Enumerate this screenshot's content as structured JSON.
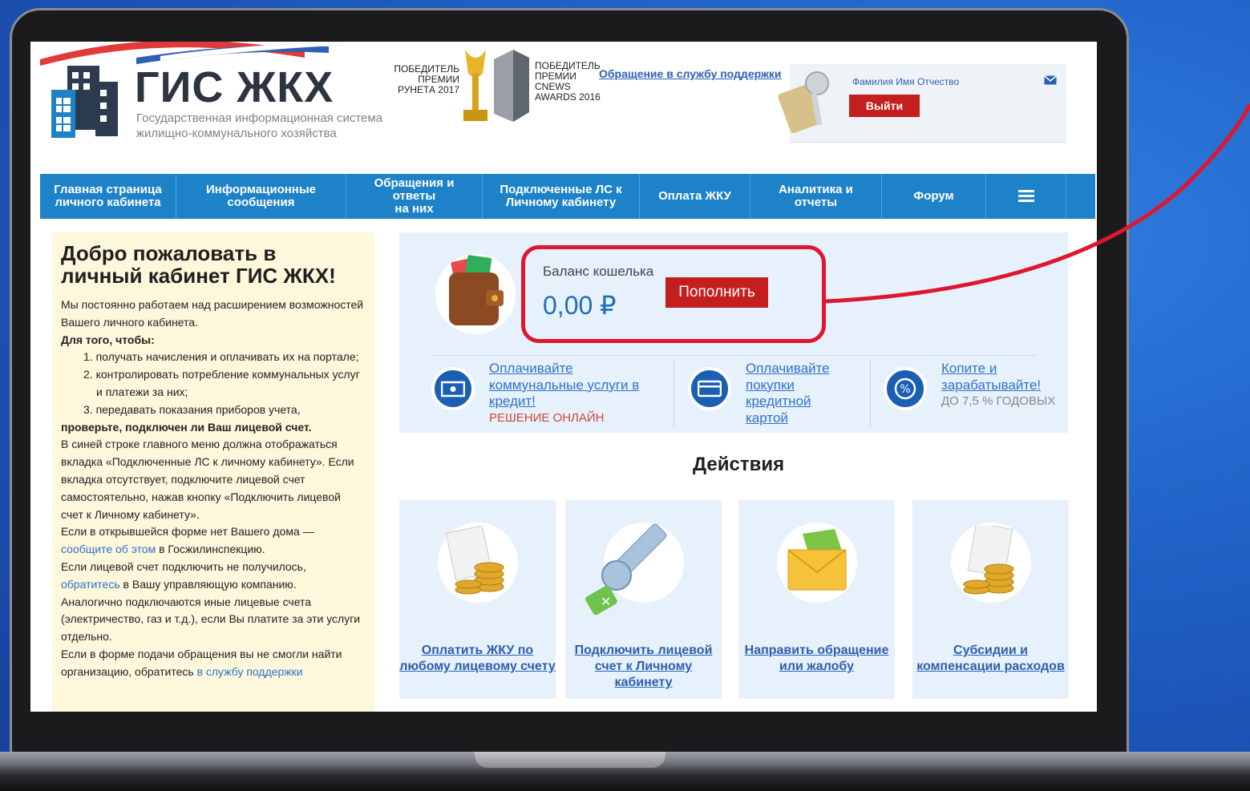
{
  "header": {
    "logo_title": "ГИС ЖКХ",
    "logo_sub_line1": "Государственная информационная система",
    "logo_sub_line2": "жилищно-коммунального хозяйства",
    "award1_line1": "ПОБЕДИТЕЛЬ",
    "award1_line2": "ПРЕМИИ",
    "award1_line3": "РУНЕТА 2017",
    "award2_line1": "ПОБЕДИТЕЛЬ",
    "award2_line2": "ПРЕМИИ",
    "award2_line3": "CNEWS",
    "award2_line4": "AWARDS 2016",
    "support_link": "Обращение в службу поддержки",
    "user_name": "Фамилия Имя Отчество",
    "logout": "Выйти"
  },
  "nav": {
    "items": [
      {
        "l1": "Главная страница",
        "l2": "личного кабинета"
      },
      {
        "l1": "Информационные",
        "l2": "сообщения"
      },
      {
        "l1": "Обращения и ответы",
        "l2": "на них"
      },
      {
        "l1": "Подключенные ЛС к",
        "l2": "Личному кабинету"
      },
      {
        "l1": "Оплата ЖКУ",
        "l2": ""
      },
      {
        "l1": "Аналитика и отчеты",
        "l2": ""
      },
      {
        "l1": "Форум",
        "l2": ""
      }
    ],
    "menu_icon": "hamburger-icon"
  },
  "left": {
    "title": "Добро пожаловать в личный кабинет ГИС ЖКХ!",
    "p1": "Мы постоянно работаем над расширением возможностей Вашего личного кабинета.",
    "p2": "Для того, чтобы:",
    "li1": "1. получать начисления и оплачивать их на портале;",
    "li2": "2. контролировать потребление коммунальных услуг и платежи за них;",
    "li3": "3. передавать показания приборов учета,",
    "p3": "проверьте, подключен ли Ваш лицевой счет.",
    "p4": "В синей строке главного меню должна отображаться вкладка «Подключенные ЛС к личному кабинету». Если вкладка отсутствует, подключите лицевой счет самостоятельно, нажав кнопку «Подключить лицевой счет к Личному кабинету».",
    "p5_a": "Если в открывшейся форме нет Вашего дома",
    "p5_b": " — ",
    "p5_link": "сообщите об этом",
    "p5_c": " в Госжилинспекцию.",
    "p6_a": "Если лицевой счет подключить не получилось, ",
    "p6_link": "обратитесь",
    "p6_c": " в Вашу управляющую компанию.",
    "p7": "Аналогично подключаются иные лицевые счета (электричество, газ и т.д.), если Вы платите за эти услуги отдельно.",
    "p8_a": "Если в форме подачи обращения вы не смогли найти организацию, обратитесь ",
    "p8_link": "в службу поддержки"
  },
  "balance": {
    "label": "Баланс кошелька",
    "value": "0,00 ₽",
    "topup": "Пополнить"
  },
  "offers": [
    {
      "link": "Оплачивайте коммунальные услуги в кредит!",
      "sub": "РЕШЕНИЕ ОНЛАЙН",
      "icon": "cash-icon"
    },
    {
      "link": "Оплачивайте покупки кредитной картой",
      "sub": "",
      "icon": "card-icon"
    },
    {
      "link": "Копите и зарабатывайте!",
      "sub": "ДО 7,5 % ГОДОВЫХ",
      "icon": "percent-icon"
    }
  ],
  "actions": {
    "title": "Действия",
    "items": [
      {
        "l1": "Оплатить ЖКУ по",
        "l2": "любому лицевому счету",
        "icon": "receipt-coins-icon"
      },
      {
        "l1": "Подключить лицевой",
        "l2": "счет к Личному кабинету",
        "icon": "key-icon"
      },
      {
        "l1": "Направить обращение",
        "l2": "или жалобу",
        "icon": "envelope-icon"
      },
      {
        "l1": "Субсидии и",
        "l2": "компенсации расходов",
        "icon": "subsidy-coins-icon"
      }
    ]
  },
  "colors": {
    "nav_blue": "#1d82c8",
    "accent_red": "#c41e1e",
    "annotation_red": "#e0172c",
    "link_blue": "#2f72c9"
  }
}
